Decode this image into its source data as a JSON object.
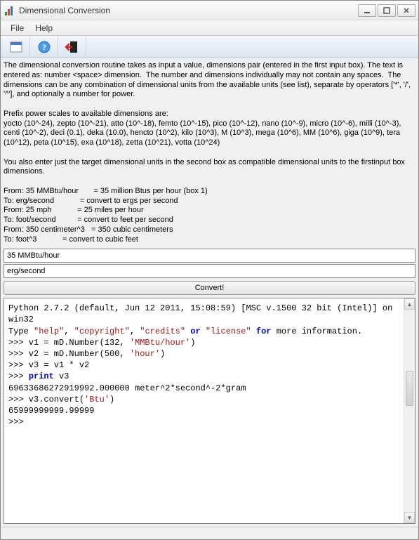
{
  "window": {
    "title": "Dimensional Conversion"
  },
  "menu": {
    "file": "File",
    "help": "Help"
  },
  "description": "The dimensional conversion routine takes as input a value, dimensions pair (entered in the first input box). The text is entered as: number <space> dimension.  The number and dimensions individually may not contain any spaces.  The dimensions can be any combination of dimensional units from the available units (see list), separate by operators ['*', '/', '^'], and optionally a number for power.\n\nPrefix power scales to available dimensions are:\nyocto (10^-24), zepto (10^-21), atto (10^-18), femto (10^-15), pico (10^-12), nano (10^-9), micro (10^-6), milli (10^-3), centi (10^-2), deci (0.1), deka (10.0), hencto (10^2), kilo (10^3), M (10^3), mega (10^6), MM (10^6), giga (10^9), tera (10^12), peta (10^15), exa (10^18), zetta (10^21), votta (10^24)\n\nYou also enter just the target dimensional units in the second box as compatible dimensional units to the firstinput box dimensions.\n\nFrom: 35 MMBtu/hour       = 35 million Btus per hour (box 1)\nTo: erg/second            = convert to ergs per second\nFrom: 25 mph            = 25 miles per hour\nTo: foot/second          = convert to feet per second\nFrom: 350 centimeter^3   = 350 cubic centimeters\nTo: foot^3            = convert to cubic feet",
  "inputs": {
    "from_value": "35 MMBtu/hour",
    "to_value": "erg/second"
  },
  "buttons": {
    "convert": "Convert!"
  },
  "console": {
    "line1_a": "Python 2.7.2 (default, Jun 12 2011, 15:08:59) [MSC v.1500 32 bit (Intel)] on win32",
    "line2_a": "Type ",
    "line2_s1": "\"help\"",
    "line2_b": ", ",
    "line2_s2": "\"copyright\"",
    "line2_c": ", ",
    "line2_s3": "\"credits\"",
    "line2_d": " ",
    "line2_kw": "or",
    "line2_e": " ",
    "line2_s4": "\"license\"",
    "line2_f": " ",
    "line2_kw2": "for",
    "line2_g": " more information.",
    "line3_a": ">>> v1 = mD.Number(132, ",
    "line3_s": "'MMBtu/hour'",
    "line3_b": ")",
    "line4_a": ">>> v2 = mD.Number(500, ",
    "line4_s": "'hour'",
    "line4_b": ")",
    "line5": ">>> v3 = v1 * v2",
    "line6_a": ">>> ",
    "line6_kw": "print",
    "line6_b": " v3",
    "line7": "69633686272919992.000000 meter^2*second^-2*gram",
    "line8_a": ">>> v3.convert(",
    "line8_s": "'Btu'",
    "line8_b": ")",
    "line9": "65999999999.99999",
    "line10": ">>> "
  }
}
